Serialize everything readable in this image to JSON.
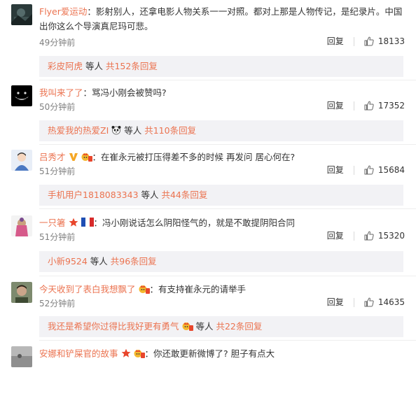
{
  "comments": [
    {
      "username": "Flyer爱运动",
      "text": "：影射别人，还拿电影人物关系一一对照。都对上那是人物传记，是纪录片。中国出你这么个导演真尼玛可悲。",
      "time": "49分钟前",
      "reply_label": "回复",
      "likes": "18133",
      "sub_user": "彩皮阿虎",
      "sub_mid": " 等人 ",
      "sub_count": "共152条回复"
    },
    {
      "username": "我叫来了了",
      "text": "：骂冯小刚会被赞吗?",
      "time": "50分钟前",
      "reply_label": "回复",
      "likes": "17352",
      "sub_user": "热爱我的热爱ZI",
      "sub_mid": " 等人 ",
      "sub_count": "共110条回复"
    },
    {
      "username": "吕秀才",
      "text": "：在崔永元被打压得差不多的时候 再发问 居心何在?",
      "time": "51分钟前",
      "reply_label": "回复",
      "likes": "15684",
      "sub_user": "手机用户1818083343",
      "sub_mid": " 等人 ",
      "sub_count": "共44条回复"
    },
    {
      "username": "一只箸",
      "text": "：冯小刚说话怎么阴阳怪气的，就是不敢提阴阳合同",
      "time": "51分钟前",
      "reply_label": "回复",
      "likes": "15320",
      "sub_user": "小新9524",
      "sub_mid": " 等人 ",
      "sub_count": "共96条回复"
    },
    {
      "username": "今天收到了表白我想飘了",
      "text": "：有支持崔永元的请举手",
      "time": "52分钟前",
      "reply_label": "回复",
      "likes": "14635",
      "sub_user": "我还是希望你过得比我好更有勇气",
      "sub_mid": " 等人 ",
      "sub_count": "共22条回复"
    },
    {
      "username": "安娜和铲屎官的故事",
      "text": "：你还敢更新微博了? 胆子有点大"
    }
  ],
  "colors": {
    "username": "#eb7350",
    "time": "#808080",
    "sub_bg": "#f2f2f5"
  }
}
